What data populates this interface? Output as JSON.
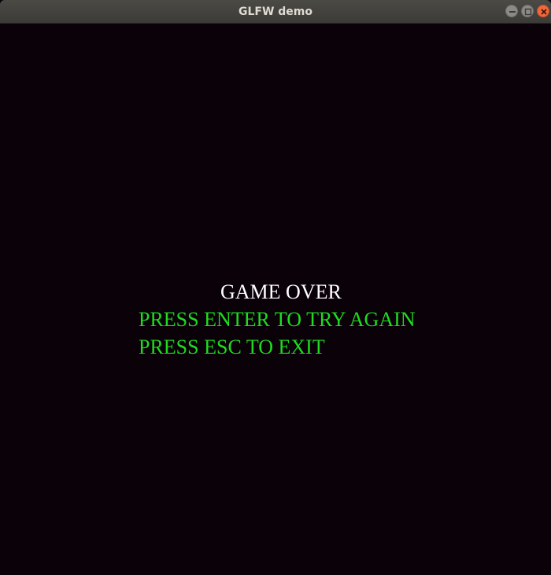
{
  "window": {
    "title": "GLFW demo",
    "controls": [
      "minimize-icon",
      "maximize-icon",
      "close-icon"
    ]
  },
  "game": {
    "status_text": "GAME OVER",
    "retry_prompt": "PRESS ENTER TO TRY AGAIN",
    "exit_prompt": "PRESS ESC TO EXIT",
    "colors": {
      "background": "#0a0109",
      "status": "#ffffff",
      "prompts": "#1fdc1f"
    }
  }
}
